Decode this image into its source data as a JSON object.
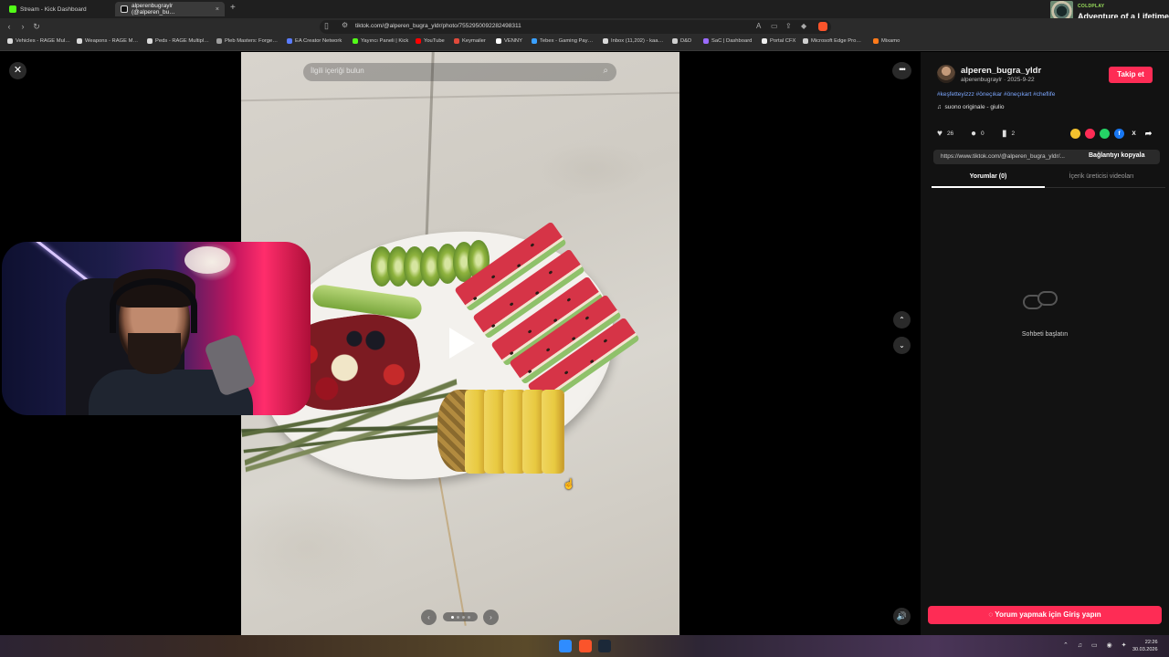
{
  "browser": {
    "tabs": [
      {
        "title": "Stream - Kick Dashboard"
      },
      {
        "title": "alperenbugraylr (@alperen_bu…",
        "close": "×"
      }
    ],
    "new_tab": "+",
    "url": "tiktok.com/@alperen_bugra_yldr/photo/7552950092282498311",
    "nav": {
      "back": "‹",
      "forward": "›",
      "reload": "↻"
    },
    "bookmarks": [
      {
        "label": "Vehicles - RAGE Mul…",
        "color": "#d9d9d9"
      },
      {
        "label": "Weapons - RAGE M…",
        "color": "#d9d9d9"
      },
      {
        "label": "Peds - RAGE Multipl…",
        "color": "#d9d9d9"
      },
      {
        "label": "Pleb Masters: Forge…",
        "color": "#9e9e9e"
      },
      {
        "label": "EA Creator Network",
        "color": "#5a7cff"
      },
      {
        "label": "Yayıncı Paneli | Kick",
        "color": "#53fc18"
      },
      {
        "label": "YouTube",
        "color": "#ff0000"
      },
      {
        "label": "Keymailer",
        "color": "#e14a3b"
      },
      {
        "label": "VENNY",
        "color": "#ffffff"
      },
      {
        "label": "Tebex - Gaming Pay…",
        "color": "#3aa0ff"
      },
      {
        "label": "Inbox (11,202) - kaa…",
        "color": "#d9d9d9"
      },
      {
        "label": "D&D",
        "color": "#cfcfcf"
      },
      {
        "label": "SaC | Dashboard",
        "color": "#9b6bff"
      },
      {
        "label": "Portal CFX",
        "color": "#eeeeee"
      },
      {
        "label": "Microsoft Edge Pro…",
        "color": "#cfcfcf"
      },
      {
        "label": "Mixamo",
        "color": "#ff7a1a"
      }
    ]
  },
  "now_playing": {
    "artist": "COLDPLAY",
    "song": "Adventure of a Lifetime"
  },
  "viewer": {
    "search_placeholder": "İlgili içeriği bulun",
    "close": "✕",
    "more": "•••",
    "up": "⌃",
    "down": "⌄",
    "volume": "🔊",
    "pager_prev": "‹",
    "pager_next": "›",
    "slide_count": 4,
    "active_slide": 1
  },
  "panel": {
    "author": "alperen_bugra_yldr",
    "handle_date": "alperenbugraylr · 2025-9-22",
    "follow": "Takip et",
    "hashtags": "#keşfetteyizzz #öneçıkar #öneçıkart #cheflife",
    "music": "suono originale - giulio",
    "likes": "26",
    "comments": "0",
    "saves": "2",
    "share_colors": {
      "yellow": "#f2c12e",
      "pink": "#fe2c55",
      "whatsapp": "#25d366",
      "facebook": "#1877f2"
    },
    "share_x": "X",
    "share_arrow": "➦",
    "link": "https://www.tiktok.com/@alperen_bugra_yldr/...",
    "copy": "Bağlantıyı kopyala",
    "tab_comments": "Yorumlar (0)",
    "tab_creator": "İçerik üreticisi videoları",
    "empty": "Sohbeti başlatın",
    "login": "Yorum yapmak için Giriş yapın"
  },
  "taskbar": {
    "time": "22:26",
    "date": "30.03.2026",
    "accent": "#fe2c55"
  }
}
